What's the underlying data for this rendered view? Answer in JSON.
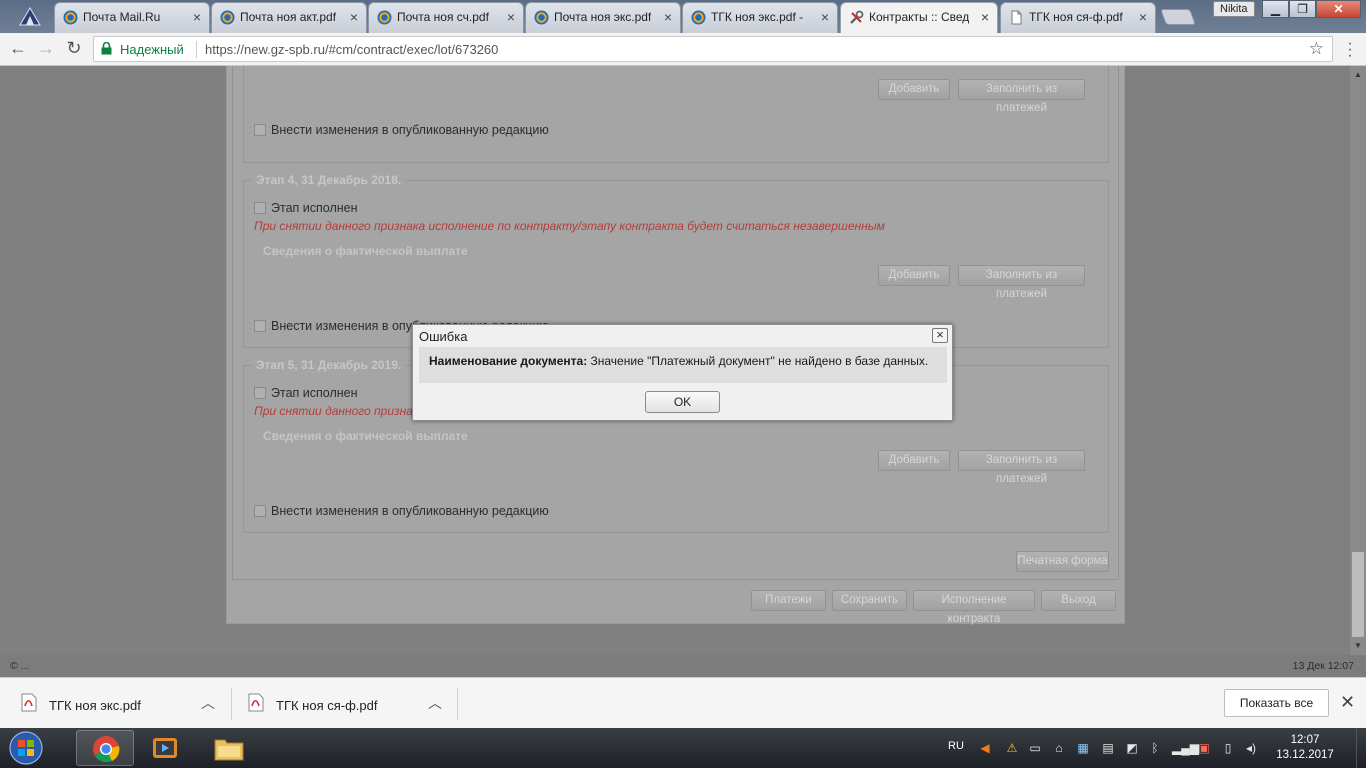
{
  "browser": {
    "tabs": [
      {
        "label": "Почта Mail.Ru",
        "icon": "mail-at-icon"
      },
      {
        "label": "Почта ноя акт.pdf",
        "icon": "mail-at-icon"
      },
      {
        "label": "Почта ноя сч.pdf",
        "icon": "mail-at-icon"
      },
      {
        "label": "Почта ноя экс.pdf",
        "icon": "mail-at-icon"
      },
      {
        "label": "ТГК ноя экс.pdf -",
        "icon": "mail-at-icon"
      },
      {
        "label": "Контракты :: Свед",
        "icon": "tools-icon",
        "active": true
      },
      {
        "label": "ТГК ноя ся-ф.pdf",
        "icon": "document-icon"
      }
    ],
    "profile_name": "Nikita",
    "omnibox": {
      "secure_label": "Надежный",
      "url": "https://new.gz-spb.ru/#cm/contract/exec/lot/673260"
    }
  },
  "page": {
    "top_buttons": {
      "add": "Добавить",
      "fill": "Заполнить из платежей"
    },
    "top_checkbox": "Внести изменения в опубликованную редакцию",
    "stages": [
      {
        "legend": "Этап 4, 31 Декабрь 2018.",
        "done_label": "Этап исполнен",
        "warning": "При снятии данного признака исполнение по контракту/этапу контракта будет считаться незавершенным",
        "subhead": "Сведения о фактической выплате",
        "add": "Добавить",
        "fill": "Заполнить из платежей",
        "publish_label": "Внести изменения в опубликованную редакцию"
      },
      {
        "legend": "Этап 5, 31 Декабрь 2019.",
        "done_label": "Этап исполнен",
        "warning": "При снятии данного признака исполнение по контракту/этапу контракта будет считаться незавершенным",
        "subhead": "Сведения о фактической выплате",
        "add": "Добавить",
        "fill": "Заполнить из платежей",
        "publish_label": "Внести изменения в опубликованную редакцию"
      }
    ],
    "print_button": "Печатная форма",
    "footer_buttons": {
      "payments": "Платежи",
      "save": "Сохранить",
      "execution": "Исполнение контракта",
      "exit": "Выход"
    },
    "status_left": "© ...",
    "status_right": "13 Дек 12:07"
  },
  "dialog": {
    "title": "Ошибка",
    "message_label": "Наименование документа:",
    "message_text": " Значение \"Платежный документ\" не найдено в базе данных.",
    "ok": "OK"
  },
  "downloads": {
    "items": [
      {
        "name": "ТГК ноя экс.pdf"
      },
      {
        "name": "ТГК ноя ся-ф.pdf"
      }
    ],
    "show_all": "Показать все"
  },
  "taskbar": {
    "language": "RU",
    "time": "12:07",
    "date": "13.12.2017"
  },
  "colors": {
    "secure_green": "#0b8043",
    "warning_red": "#b53c3c",
    "tabstrip_blue": "#5b6d86"
  }
}
